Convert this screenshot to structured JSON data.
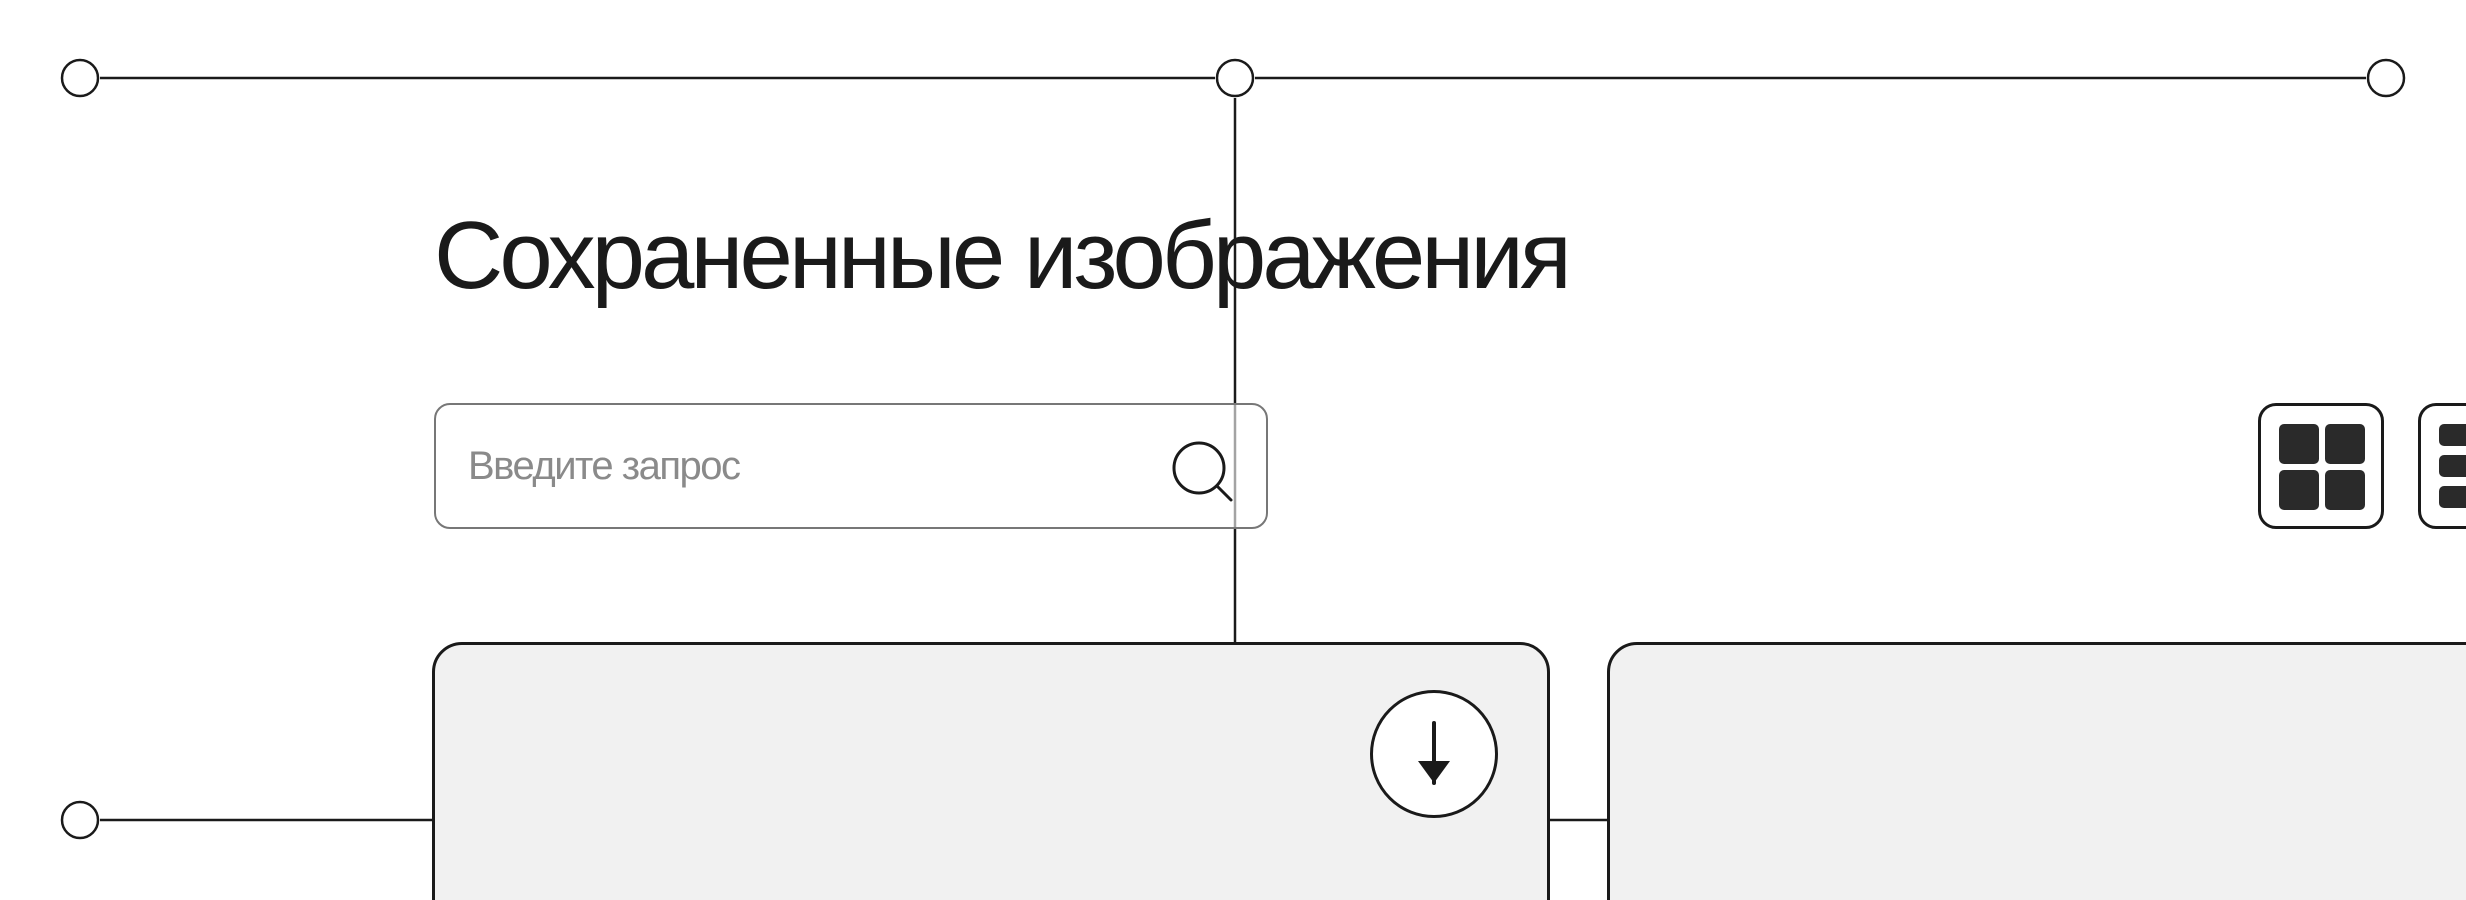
{
  "page": {
    "title": "Сохраненные изображения"
  },
  "search": {
    "placeholder": "Введите запрос",
    "value": "",
    "icon": "search-icon"
  },
  "view_toggle": {
    "options": [
      {
        "name": "grid-view",
        "icon": "grid-icon",
        "active": true
      },
      {
        "name": "list-view",
        "icon": "list-icon",
        "active": false
      }
    ]
  },
  "cards": [
    {
      "name": "saved-image-card-1",
      "action_icon": "download-icon"
    },
    {
      "name": "saved-image-card-2"
    }
  ],
  "colors": {
    "background": "#ffffff",
    "ink": "#1a1a1a",
    "card_fill": "#f0f0f0",
    "muted_border": "#777777"
  }
}
